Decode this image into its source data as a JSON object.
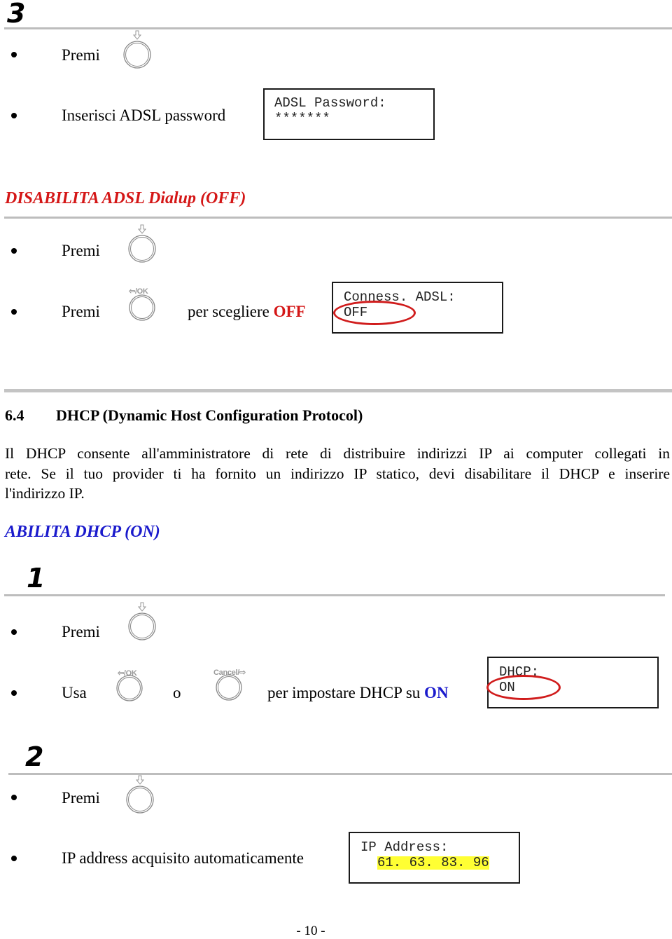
{
  "step_3": {
    "number": "3",
    "items": [
      {
        "text": "Premi",
        "button": "down-arrow-button"
      },
      {
        "text": "Inserisci ADSL password"
      }
    ],
    "lcd": {
      "line1": "ADSL Password:",
      "line2": "*******"
    }
  },
  "disable_section": {
    "title": "DISABILITA ADSL Dialup (OFF)",
    "items": [
      {
        "text": "Premi",
        "button": "down-arrow-button"
      },
      {
        "text": "Premi",
        "button": "left-ok-button",
        "button_label": "⇦/OK",
        "suffix": "per scegliere ",
        "value": "OFF"
      }
    ],
    "lcd": {
      "line1": "Conness. ADSL:",
      "line2": "OFF"
    }
  },
  "section_6_4": {
    "number": "6.4",
    "title": "DHCP (Dynamic Host Configuration Protocol)",
    "paragraph_lines": [
      "Il DHCP consente all'amministratore di rete di distribuire indirizzi IP ai computer collegati in",
      "rete.  Se il tuo provider ti ha fornito un indirizzo IP statico, devi disabilitare il DHCP e inserire",
      "l'indirizzo IP."
    ]
  },
  "enable_section": {
    "title": "ABILITA DHCP (ON)",
    "step_1": {
      "number": "1",
      "items": [
        {
          "text": "Premi",
          "button": "down-arrow-button"
        },
        {
          "text": "Usa",
          "button1_label": "⇦/OK",
          "connector": "o",
          "button2_label": "Cancel/⇨",
          "suffix": "per impostare DHCP su ",
          "value": "ON"
        }
      ],
      "lcd": {
        "line1": "DHCP:",
        "line2": "ON"
      }
    },
    "step_2": {
      "number": "2",
      "items": [
        {
          "text": "Premi",
          "button": "down-arrow-button"
        },
        {
          "text": "IP address acquisito automaticamente"
        }
      ],
      "lcd": {
        "line1": "IP Address:",
        "line2": "61. 63. 83. 96"
      }
    }
  },
  "footer": {
    "page_number": "- 10 -"
  },
  "colors": {
    "red": "#d41616",
    "blue": "#1a1acc",
    "highlight": "#ffff33",
    "rule": "#bdbdbd"
  }
}
